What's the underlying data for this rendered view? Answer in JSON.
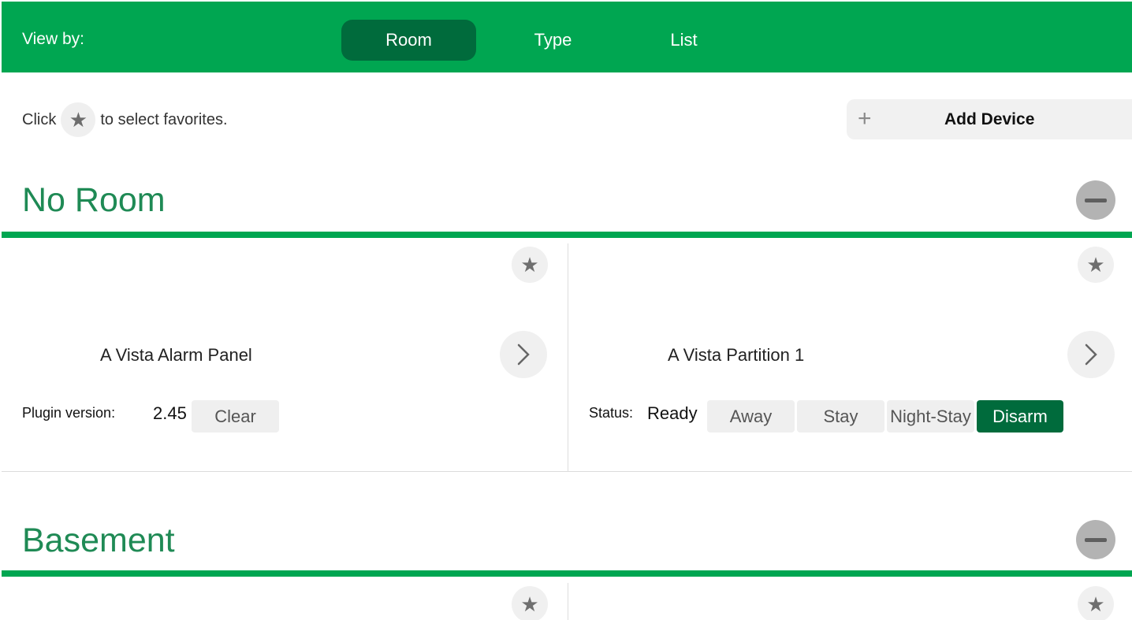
{
  "topbar": {
    "view_by_label": "View by:",
    "tabs": [
      {
        "label": "Room",
        "active": true
      },
      {
        "label": "Type",
        "active": false
      },
      {
        "label": "List",
        "active": false
      }
    ],
    "bg_color": "#00a651",
    "active_tab_color": "#006b3c"
  },
  "favorites_hint": {
    "prefix": "Click",
    "suffix": "to select favorites.",
    "icon": "star-icon"
  },
  "add_device": {
    "icon": "plus-icon",
    "label": "Add Device"
  },
  "rooms": [
    {
      "title": "No Room",
      "devices": [
        {
          "name": "A Vista Alarm Panel",
          "plugin_version_label": "Plugin version:",
          "plugin_version": "2.45",
          "clear_label": "Clear"
        },
        {
          "name": "A Vista Partition 1",
          "status_label": "Status:",
          "status_value": "Ready",
          "actions": [
            "Away",
            "Stay",
            "Night-Stay",
            "Disarm"
          ],
          "active_action": "Disarm"
        }
      ]
    },
    {
      "title": "Basement",
      "devices": []
    }
  ],
  "icons": {
    "star": "★",
    "plus": "+"
  }
}
